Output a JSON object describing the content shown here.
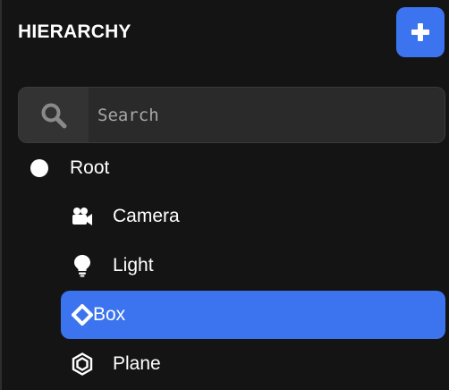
{
  "panel": {
    "title": "HIERARCHY",
    "add_button_icon": "plus-icon"
  },
  "search": {
    "placeholder": "Search",
    "value": "",
    "icon": "search-icon"
  },
  "tree": {
    "root": {
      "label": "Root",
      "icon": "circle-icon"
    },
    "children": [
      {
        "label": "Camera",
        "icon": "video-camera-icon",
        "selected": false
      },
      {
        "label": "Light",
        "icon": "lightbulb-icon",
        "selected": false
      },
      {
        "label": "Box",
        "icon": "diamond-icon",
        "selected": true
      },
      {
        "label": "Plane",
        "icon": "hexagon-icon",
        "selected": false
      }
    ]
  },
  "colors": {
    "background": "#141414",
    "accent": "#3c74ef",
    "search_bg": "#2a2a2a"
  }
}
